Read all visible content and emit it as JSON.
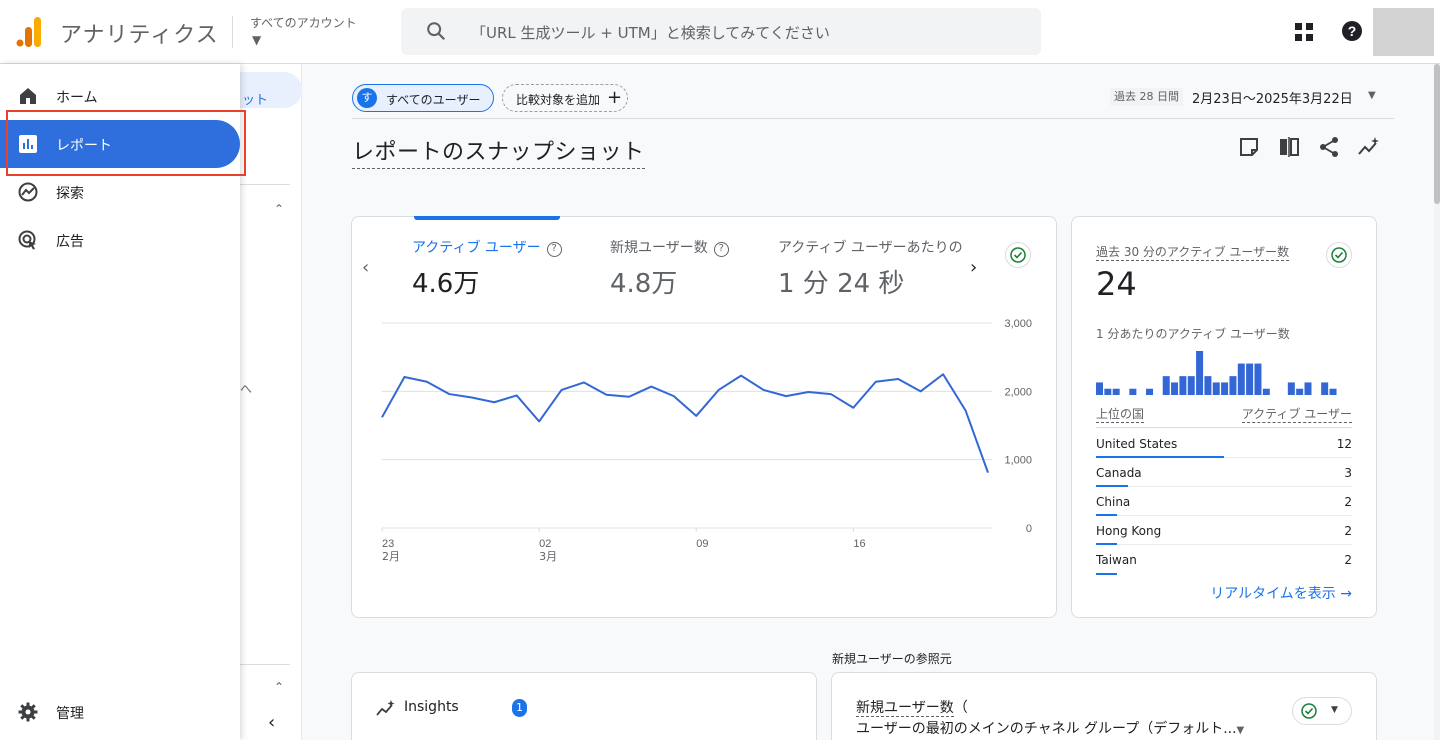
{
  "app": {
    "title": "アナリティクス",
    "account_label": "すべてのアカウント",
    "search_placeholder": "「URL 生成ツール + UTM」と検索してみてください"
  },
  "nav": {
    "items": [
      {
        "label": "ホーム",
        "icon": "home-icon"
      },
      {
        "label": "レポート",
        "icon": "bar-chart-icon",
        "active": true
      },
      {
        "label": "探索",
        "icon": "explore-icon"
      },
      {
        "label": "広告",
        "icon": "ads-icon"
      }
    ],
    "admin_label": "管理",
    "subnav_pill_text": "ット",
    "subnav_mark": "へ"
  },
  "header": {
    "segment_badge": "す",
    "segment_label": "すべてのユーザー",
    "compare_label": "比較対象を追加",
    "date_badge": "過去 28 日間",
    "date_range": "2月23日～2025年3月22日",
    "page_title": "レポートのスナップショット"
  },
  "metrics": [
    {
      "label": "アクティブ ユーザー",
      "value": "4.6万",
      "selected": true
    },
    {
      "label": "新規ユーザー数",
      "value": "4.8万"
    },
    {
      "label": "アクティブ ユーザーあたりの",
      "value": "1 分 24 秒"
    }
  ],
  "chart_data": {
    "type": "line",
    "x_tick_labels": [
      {
        "day": "23",
        "month": "2月"
      },
      {
        "day": "02",
        "month": "3月"
      },
      {
        "day": "09",
        "month": ""
      },
      {
        "day": "16",
        "month": ""
      }
    ],
    "y_tick_labels": [
      "3,000",
      "2,000",
      "1,000",
      "0"
    ],
    "ylim": [
      0,
      3000
    ],
    "grid": true,
    "series": [
      {
        "color": "#3367d6",
        "values": [
          1620,
          2210,
          2140,
          1960,
          1910,
          1840,
          1940,
          1560,
          2020,
          2130,
          1950,
          1920,
          2070,
          1930,
          1640,
          2020,
          2230,
          2020,
          1930,
          1990,
          1960,
          1760,
          2140,
          2180,
          2000,
          2250,
          1720,
          810
        ]
      }
    ]
  },
  "realtime": {
    "title": "過去 30 分のアクティブ ユーザー数",
    "value": "24",
    "per_minute_label": "1 分あたりのアクティブ ユーザー数",
    "per_minute_values": [
      2,
      1,
      1,
      0,
      1,
      0,
      1,
      0,
      3,
      2,
      3,
      3,
      7,
      3,
      2,
      2,
      3,
      5,
      5,
      5,
      1,
      0,
      0,
      2,
      1,
      2,
      0,
      2,
      1
    ],
    "col_country": "上位の国",
    "col_users": "アクティブ ユーザー",
    "rows": [
      {
        "country": "United States",
        "users": "12",
        "share": 0.5
      },
      {
        "country": "Canada",
        "users": "3",
        "share": 0.125
      },
      {
        "country": "China",
        "users": "2",
        "share": 0.083
      },
      {
        "country": "Hong Kong",
        "users": "2",
        "share": 0.083
      },
      {
        "country": "Taiwan",
        "users": "2",
        "share": 0.083
      }
    ],
    "link": "リアルタイムを表示"
  },
  "bottom": {
    "section_label": "新規ユーザーの参照元",
    "insights_label": "Insights",
    "insights_count": "1",
    "ref_title": "新規ユーザー数",
    "ref_paren": "（",
    "ref_subtitle": "ユーザーの最初のメインのチャネル グループ（デフォルト..."
  },
  "colors": {
    "accent": "#1a73e8",
    "active_nav": "#2f6fdd",
    "check": "#188038",
    "highlight": "#e8412c"
  }
}
